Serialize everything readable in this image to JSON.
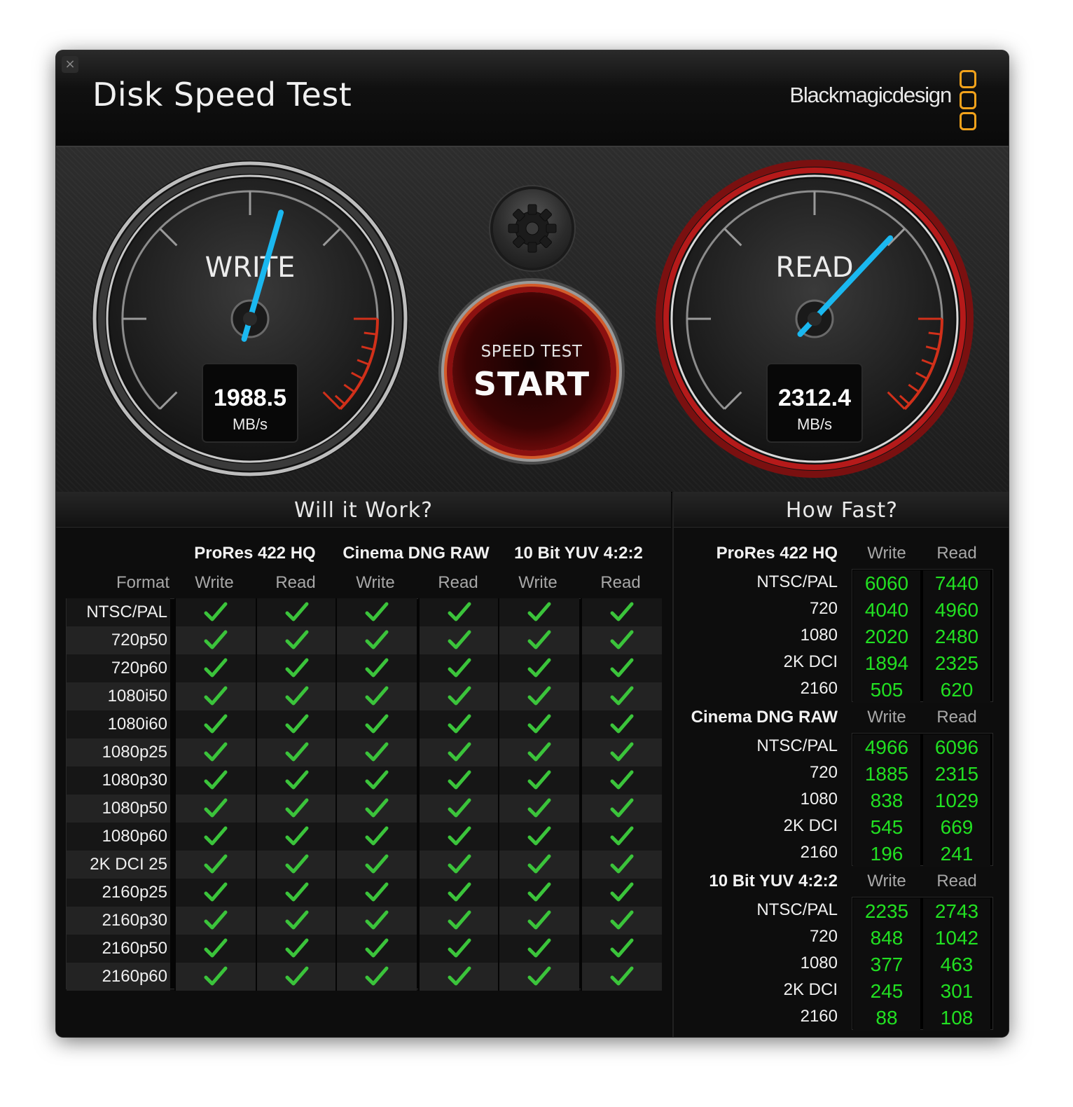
{
  "window": {
    "title": "Disk Speed Test",
    "brand": "Blackmagicdesign",
    "close_label": "×"
  },
  "write_gauge": {
    "label": "WRITE",
    "value": "1988.5",
    "unit": "MB/s",
    "needle_fraction": 0.56
  },
  "read_gauge": {
    "label": "READ",
    "value": "2312.4",
    "unit": "MB/s",
    "needle_fraction": 0.66
  },
  "start_button": {
    "top": "SPEED TEST",
    "main": "START"
  },
  "will_it_work": {
    "title": "Will it Work?",
    "format_header": "Format",
    "codecs": [
      "ProRes 422 HQ",
      "Cinema DNG RAW",
      "10 Bit YUV 4:2:2"
    ],
    "columns": [
      "Write",
      "Read",
      "Write",
      "Read",
      "Write",
      "Read"
    ],
    "formats": [
      "NTSC/PAL",
      "720p50",
      "720p60",
      "1080i50",
      "1080i60",
      "1080p25",
      "1080p30",
      "1080p50",
      "1080p60",
      "2K DCI 25",
      "2160p25",
      "2160p30",
      "2160p50",
      "2160p60"
    ],
    "result": "check"
  },
  "how_fast": {
    "title": "How Fast?",
    "groups": [
      {
        "name": "ProRes 422 HQ",
        "write": "Write",
        "read": "Read",
        "rows": [
          {
            "label": "NTSC/PAL",
            "w": "6060",
            "r": "7440"
          },
          {
            "label": "720",
            "w": "4040",
            "r": "4960"
          },
          {
            "label": "1080",
            "w": "2020",
            "r": "2480"
          },
          {
            "label": "2K DCI",
            "w": "1894",
            "r": "2325"
          },
          {
            "label": "2160",
            "w": "505",
            "r": "620"
          }
        ]
      },
      {
        "name": "Cinema DNG RAW",
        "write": "Write",
        "read": "Read",
        "rows": [
          {
            "label": "NTSC/PAL",
            "w": "4966",
            "r": "6096"
          },
          {
            "label": "720",
            "w": "1885",
            "r": "2315"
          },
          {
            "label": "1080",
            "w": "838",
            "r": "1029"
          },
          {
            "label": "2K DCI",
            "w": "545",
            "r": "669"
          },
          {
            "label": "2160",
            "w": "196",
            "r": "241"
          }
        ]
      },
      {
        "name": "10 Bit YUV 4:2:2",
        "write": "Write",
        "read": "Read",
        "rows": [
          {
            "label": "NTSC/PAL",
            "w": "2235",
            "r": "2743"
          },
          {
            "label": "720",
            "w": "848",
            "r": "1042"
          },
          {
            "label": "1080",
            "w": "377",
            "r": "463"
          },
          {
            "label": "2K DCI",
            "w": "245",
            "r": "301"
          },
          {
            "label": "2160",
            "w": "88",
            "r": "108"
          }
        ]
      }
    ]
  },
  "colors": {
    "needle": "#1ab8f0",
    "value_green": "#22e022",
    "check_green": "#3bc43b",
    "accent_orange": "#f2a21b",
    "read_ring": "#b51a1a"
  }
}
